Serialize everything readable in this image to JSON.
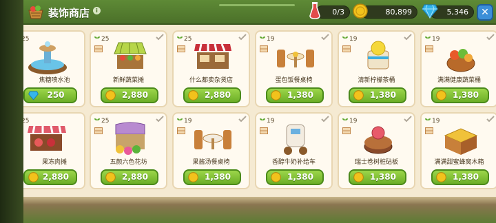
{
  "header": {
    "title": "装饰商店",
    "info_label": "i",
    "close_label": "✕"
  },
  "resources": [
    {
      "name": "potion",
      "value": "0/3",
      "color": "#e24c4c"
    },
    {
      "name": "coin",
      "value": "80,899",
      "color": "#f2c21c"
    },
    {
      "name": "gem",
      "value": "5,346",
      "color": "#35b6ec"
    }
  ],
  "items": [
    {
      "name": "焦糖喷水池",
      "level": "25",
      "price": "250",
      "currency": "gem",
      "show_level_icon": false
    },
    {
      "name": "新鲜蔬菜摊",
      "level": "25",
      "price": "2,880",
      "currency": "coin",
      "show_level_icon": true
    },
    {
      "name": "什么都卖杂货店",
      "level": "25",
      "price": "2,880",
      "currency": "coin",
      "show_level_icon": true
    },
    {
      "name": "蛋包饭餐桌椅",
      "level": "19",
      "price": "1,380",
      "currency": "coin",
      "show_level_icon": true
    },
    {
      "name": "清新柠檬茶桶",
      "level": "19",
      "price": "1,380",
      "currency": "coin",
      "show_level_icon": true
    },
    {
      "name": "满满健康蔬菜桶",
      "level": "19",
      "price": "1,380",
      "currency": "coin",
      "show_level_icon": true
    },
    {
      "name": "果冻肉摊",
      "level": "25",
      "price": "2,880",
      "currency": "coin",
      "show_level_icon": false
    },
    {
      "name": "五颜六色花坊",
      "level": "25",
      "price": "2,880",
      "currency": "coin",
      "show_level_icon": true
    },
    {
      "name": "果酱汤餐桌椅",
      "level": "19",
      "price": "1,380",
      "currency": "coin",
      "show_level_icon": true
    },
    {
      "name": "香醇牛奶补给车",
      "level": "19",
      "price": "1,380",
      "currency": "coin",
      "show_level_icon": true
    },
    {
      "name": "瑞士卷树桩砧板",
      "level": "19",
      "price": "1,380",
      "currency": "coin",
      "show_level_icon": true
    },
    {
      "name": "满满甜蜜蜂窝木箱",
      "level": "19",
      "price": "1,380",
      "currency": "coin",
      "show_level_icon": true
    }
  ],
  "colors": {
    "accent_green": "#6cae27",
    "header_green": "#5e8a36",
    "panel_cream": "#f5ead2"
  }
}
